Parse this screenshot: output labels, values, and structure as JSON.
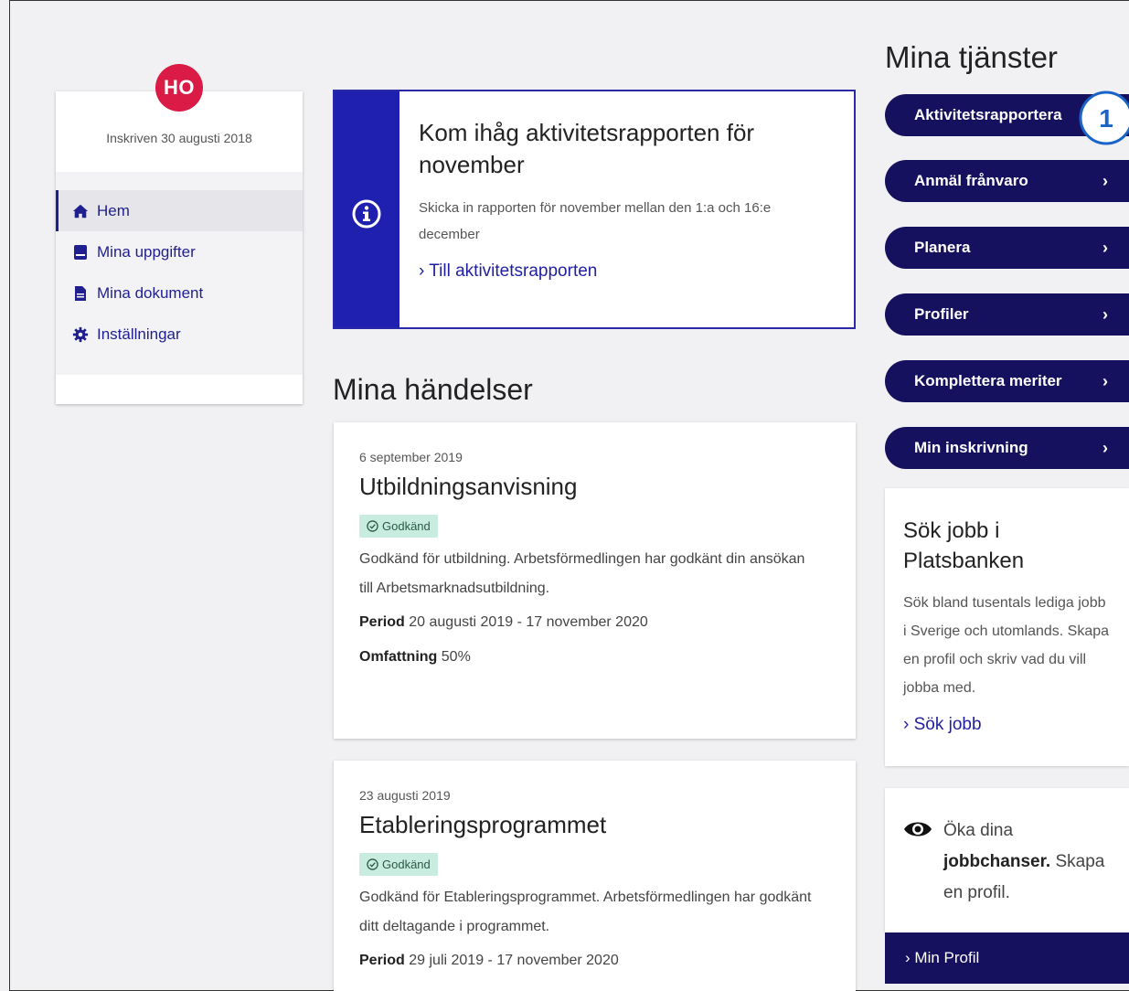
{
  "profile": {
    "initials": "HO",
    "enrolled_text": "Inskriven 30 augusti 2018"
  },
  "nav": [
    {
      "label": "Hem",
      "icon": "home-icon",
      "active": true
    },
    {
      "label": "Mina uppgifter",
      "icon": "address-book-icon"
    },
    {
      "label": "Mina dokument",
      "icon": "document-icon"
    },
    {
      "label": "Inställningar",
      "icon": "gear-icon"
    }
  ],
  "notice": {
    "title": "Kom ihåg aktivitetsrapporten för november",
    "text": "Skicka in rapporten för november mellan den 1:a och 16:e december",
    "link": "Till aktivitetsrapporten",
    "icon": "info-icon"
  },
  "events_title": "Mina händelser",
  "events": [
    {
      "date": "6 september 2019",
      "title": "Utbildningsanvisning",
      "status": "Godkänd",
      "description": "Godkänd för utbildning. Arbetsförmedlingen har godkänt din ansökan till Arbetsmarknadsutbildning.",
      "period_label": "Period",
      "period_value": "20 augusti 2019 - 17 november 2020",
      "scope_label": "Omfattning",
      "scope_value": "50%"
    },
    {
      "date": "23 augusti 2019",
      "title": "Etableringsprogrammet",
      "status": "Godkänd",
      "description": "Godkänd för Etableringsprogrammet. Arbetsförmedlingen har godkänt ditt deltagande i programmet.",
      "period_label": "Period",
      "period_value": "29 juli 2019 - 17 november 2020"
    }
  ],
  "services_title": "Mina tjänster",
  "services": [
    {
      "label": "Aktivitetsrapportera"
    },
    {
      "label": "Anmäl frånvaro"
    },
    {
      "label": "Planera"
    },
    {
      "label": "Profiler"
    },
    {
      "label": "Komplettera meriter"
    },
    {
      "label": "Min inskrivning"
    }
  ],
  "step_badge": "1",
  "jobsearch": {
    "title": "Sök jobb i Platsbanken",
    "text": "Sök bland tusentals lediga jobb i Sverige och utomlands. Skapa en profil och skriv vad du vill jobba med.",
    "link": "Sök jobb"
  },
  "chances": {
    "text_prefix": "Öka dina",
    "text_bold": "jobbchanser.",
    "text_suffix": "Skapa en profil.",
    "icon": "eye-icon",
    "button": "Min Profil"
  },
  "colors": {
    "brand_navy": "#16115e",
    "accent_blue": "#1f1fb0",
    "avatar_red": "#d91b46",
    "badge_green": "#c9ece0"
  }
}
